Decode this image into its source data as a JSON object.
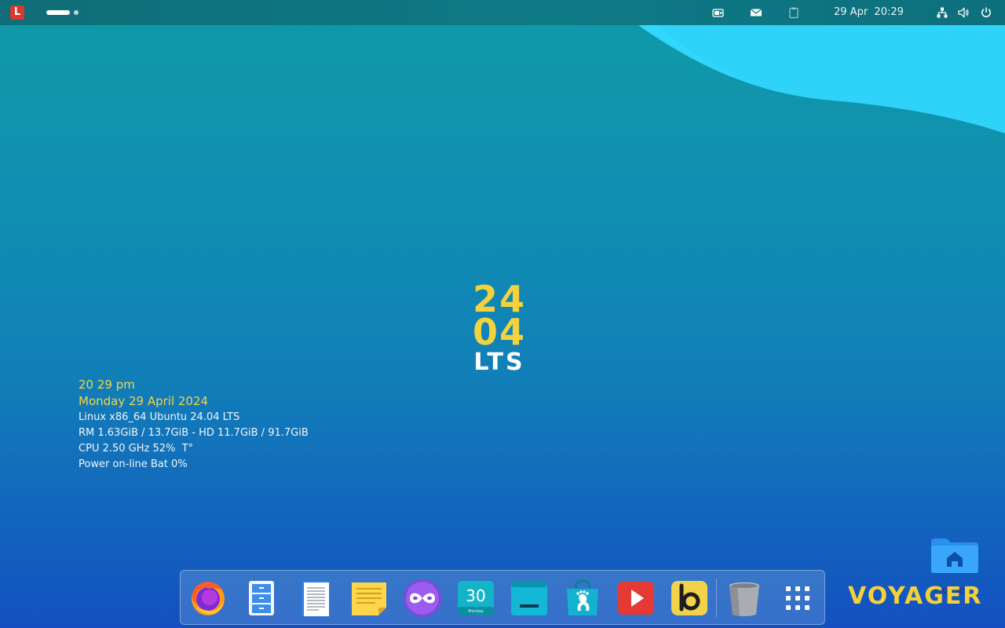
{
  "top_panel": {
    "app_menu_letter": "L",
    "clock": "29 Apr  20:29",
    "tray_icons": [
      "battery-status-icon",
      "mail-icon",
      "clipboard-icon",
      "network-icon",
      "volume-icon",
      "power-icon"
    ]
  },
  "center_logo": {
    "line1": "24",
    "line2": "04",
    "line3": "LTS"
  },
  "conky": {
    "time": "20 29 pm",
    "date": "Monday 29 April 2024",
    "system": "Linux x86_64 Ubuntu 24.04 LTS",
    "memory": "RM 1.63GiB / 13.7GiB - HD 11.7GiB / 91.7GiB",
    "cpu": "CPU 2.50 GHz 52%  T°",
    "power": "Power on-line Bat 0%"
  },
  "desktop": {
    "home_label": "Home",
    "brand": "VOYAGER"
  },
  "dock": {
    "items": [
      {
        "name": "firefox",
        "icon": "firefox-icon"
      },
      {
        "name": "file-manager",
        "icon": "file-cabinet-icon"
      },
      {
        "name": "text-editor",
        "icon": "document-icon"
      },
      {
        "name": "notes",
        "icon": "sticky-notes-icon"
      },
      {
        "name": "tor-browser",
        "icon": "infinity-mask-icon"
      },
      {
        "name": "calendar",
        "icon": "calendar-icon",
        "day": "30",
        "weekday": "Monday"
      },
      {
        "name": "terminal",
        "icon": "terminal-icon"
      },
      {
        "name": "software-store",
        "icon": "store-bag-icon"
      },
      {
        "name": "video-player",
        "icon": "play-icon"
      },
      {
        "name": "bookmarks",
        "icon": "b-app-icon"
      },
      {
        "name": "trash",
        "icon": "trash-icon"
      },
      {
        "name": "show-apps",
        "icon": "app-grid-icon"
      }
    ]
  },
  "colors": {
    "accent_yellow": "#f4d13a",
    "wave_cyan": "#2fd2f8",
    "panel_teal": "#0f6d77"
  }
}
